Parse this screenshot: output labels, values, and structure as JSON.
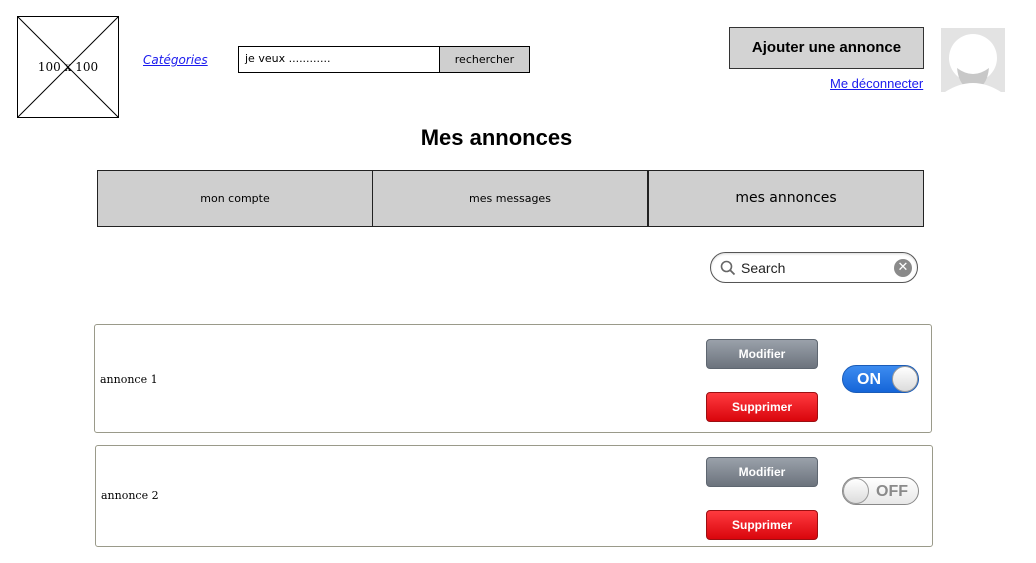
{
  "header": {
    "logo_label": "100 x 100",
    "categories_link": "Catégories",
    "search_placeholder": "je veux ............",
    "search_button": "rechercher",
    "add_button": "Ajouter une annonce",
    "logout_link": "Me déconnecter",
    "avatar_icon": "user-avatar-icon"
  },
  "page": {
    "title": "Mes annonces"
  },
  "tabs": [
    {
      "label": "mon compte"
    },
    {
      "label": "mes messages"
    },
    {
      "label": "mes annonces"
    }
  ],
  "filter": {
    "placeholder": "Search",
    "search_icon": "magnifier-icon",
    "clear_icon": "clear-icon"
  },
  "annonces": [
    {
      "name": "annonce 1",
      "modify": "Modifier",
      "delete": "Supprimer",
      "toggle": "ON"
    },
    {
      "name": "annonce 2",
      "modify": "Modifier",
      "delete": "Supprimer",
      "toggle": "OFF"
    }
  ],
  "colors": {
    "link": "#1a1aee",
    "toggle_on": "#1565d8",
    "delete": "#d9050c",
    "modify": "#6c737d"
  }
}
